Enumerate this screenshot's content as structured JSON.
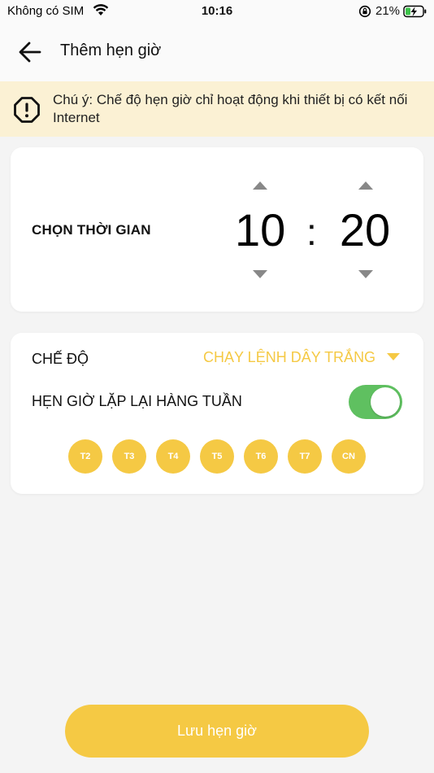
{
  "status_bar": {
    "carrier": "Không có SIM",
    "time": "10:16",
    "battery_percent": "21%",
    "wifi_icon": "wifi-icon",
    "rotation_lock_icon": "rotation-lock-icon",
    "battery_icon": "battery-charging-icon"
  },
  "header": {
    "title": "Thêm hẹn giờ",
    "back_icon": "arrow-left-icon"
  },
  "notice": {
    "icon": "alert-octagon-icon",
    "text": "Chú ý: Chế độ hẹn giờ chỉ hoạt động khi thiết bị có kết nối Internet"
  },
  "time_picker": {
    "label": "CHỌN THỜI GIAN",
    "hour": "10",
    "separator": ":",
    "minute": "20"
  },
  "mode": {
    "label": "CHẾ ĐỘ",
    "value": "CHẠY LỆNH DÂY TRẮNG"
  },
  "repeat": {
    "label": "HẸN GIỜ LẶP LẠI HÀNG TUẦN",
    "enabled": true
  },
  "days": [
    "T2",
    "T3",
    "T4",
    "T5",
    "T6",
    "T7",
    "CN"
  ],
  "save_button": "Lưu hẹn giờ",
  "colors": {
    "accent": "#f5c944",
    "toggle_on": "#5fc060",
    "notice_bg": "#fbf1d4"
  }
}
